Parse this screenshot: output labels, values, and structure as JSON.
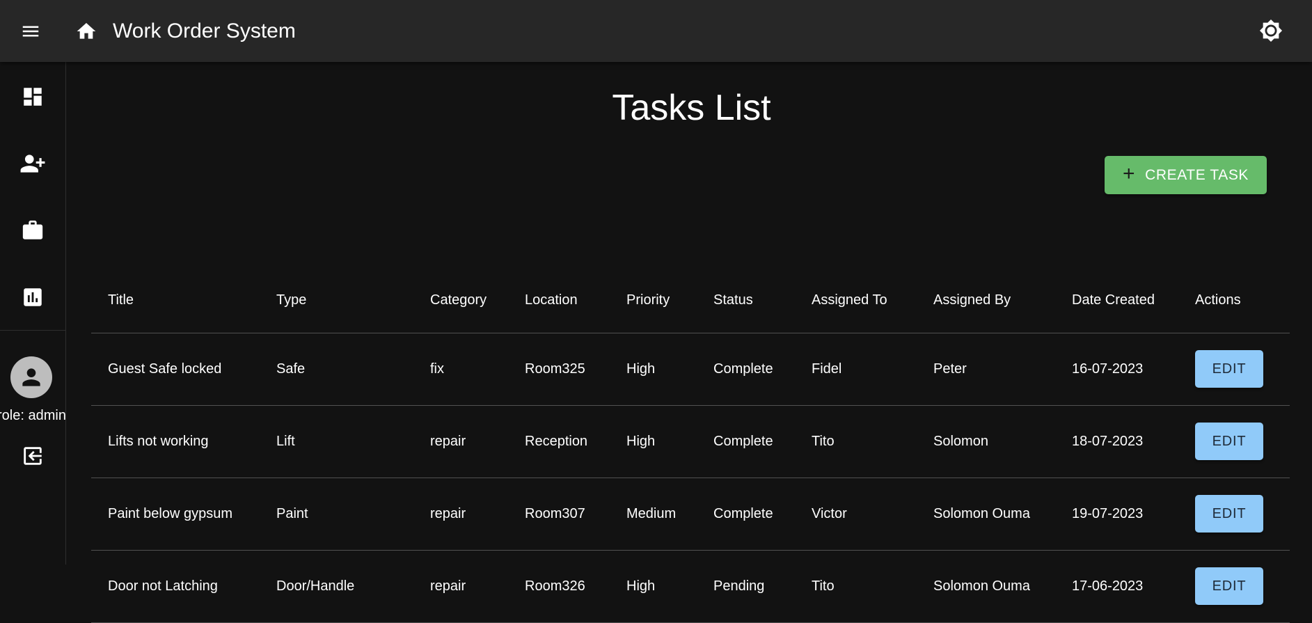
{
  "appbar": {
    "title": "Work Order System",
    "menu_icon": "menu-icon",
    "home_icon": "home-icon",
    "theme_icon": "brightness-icon"
  },
  "sidebar": {
    "items": [
      {
        "icon": "dashboard-icon"
      },
      {
        "icon": "add-user-icon"
      },
      {
        "icon": "briefcase-icon"
      },
      {
        "icon": "report-icon"
      }
    ],
    "role_text": "role: admin",
    "logout_icon": "logout-icon"
  },
  "page": {
    "title": "Tasks List",
    "create_label": "CREATE TASK"
  },
  "table": {
    "headers": [
      "Title",
      "Type",
      "Category",
      "Location",
      "Priority",
      "Status",
      "Assigned To",
      "Assigned By",
      "Date Created",
      "Actions"
    ],
    "rows": [
      {
        "title": "Guest Safe locked",
        "type": "Safe",
        "category": "fix",
        "location": "Room325",
        "priority": "High",
        "status": "Complete",
        "assigned_to": "Fidel",
        "assigned_by": "Peter",
        "date_created": "16-07-2023",
        "action": "EDIT"
      },
      {
        "title": "Lifts not working",
        "type": "Lift",
        "category": "repair",
        "location": "Reception",
        "priority": "High",
        "status": "Complete",
        "assigned_to": "Tito",
        "assigned_by": "Solomon",
        "date_created": "18-07-2023",
        "action": "EDIT"
      },
      {
        "title": "Paint below gypsum",
        "type": "Paint",
        "category": "repair",
        "location": "Room307",
        "priority": "Medium",
        "status": "Complete",
        "assigned_to": "Victor",
        "assigned_by": "Solomon Ouma",
        "date_created": "19-07-2023",
        "action": "EDIT"
      },
      {
        "title": "Door not Latching",
        "type": "Door/Handle",
        "category": "repair",
        "location": "Room326",
        "priority": "High",
        "status": "Pending",
        "assigned_to": "Tito",
        "assigned_by": "Solomon Ouma",
        "date_created": "17-06-2023",
        "action": "EDIT"
      }
    ]
  },
  "colors": {
    "appbar": "#272727",
    "background": "#121212",
    "create_button": "#66bb6a",
    "edit_button": "#90caf9"
  }
}
